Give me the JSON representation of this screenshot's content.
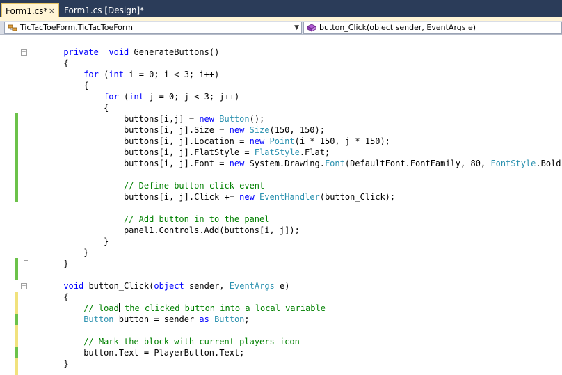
{
  "tabs": [
    {
      "label": "Form1.cs*",
      "close": "×",
      "active": true
    },
    {
      "label": "Form1.cs [Design]*",
      "active": false
    }
  ],
  "nav": {
    "type_combo": "TicTacToeForm.TicTacToeForm",
    "member_combo": "button_Click(object sender, EventArgs e)"
  },
  "colors": {
    "keyword": "#0000ff",
    "type": "#2b91af",
    "comment": "#008000",
    "saved_marker": "#6cc24a",
    "unsaved_marker": "#f1e27d",
    "tab_bg": "#2b3c59"
  },
  "code": {
    "lines": [
      {
        "indent": 6,
        "tokens": [
          [
            "kw",
            "private"
          ],
          [
            "",
            "  "
          ],
          [
            "kw",
            "void"
          ],
          [
            "",
            " GenerateButtons()"
          ]
        ]
      },
      {
        "indent": 6,
        "tokens": [
          [
            "",
            "{"
          ]
        ]
      },
      {
        "indent": 10,
        "tokens": [
          [
            "kw",
            "for"
          ],
          [
            "",
            " ("
          ],
          [
            "kw",
            "int"
          ],
          [
            "",
            " i = 0; i < 3; i++)"
          ]
        ]
      },
      {
        "indent": 10,
        "tokens": [
          [
            "",
            "{"
          ]
        ]
      },
      {
        "indent": 14,
        "tokens": [
          [
            "kw",
            "for"
          ],
          [
            "",
            " ("
          ],
          [
            "kw",
            "int"
          ],
          [
            "",
            " j = 0; j < 3; j++)"
          ]
        ]
      },
      {
        "indent": 14,
        "tokens": [
          [
            "",
            "{"
          ]
        ]
      },
      {
        "indent": 18,
        "tokens": [
          [
            "",
            "buttons[i,j] = "
          ],
          [
            "kw",
            "new"
          ],
          [
            "",
            " "
          ],
          [
            "ty",
            "Button"
          ],
          [
            "",
            "();"
          ]
        ]
      },
      {
        "indent": 18,
        "tokens": [
          [
            "",
            "buttons[i, j].Size = "
          ],
          [
            "kw",
            "new"
          ],
          [
            "",
            " "
          ],
          [
            "ty",
            "Size"
          ],
          [
            "",
            "(150, 150);"
          ]
        ]
      },
      {
        "indent": 18,
        "tokens": [
          [
            "",
            "buttons[i, j].Location = "
          ],
          [
            "kw",
            "new"
          ],
          [
            "",
            " "
          ],
          [
            "ty",
            "Point"
          ],
          [
            "",
            "(i * 150, j * 150);"
          ]
        ]
      },
      {
        "indent": 18,
        "tokens": [
          [
            "",
            "buttons[i, j].FlatStyle = "
          ],
          [
            "ty",
            "FlatStyle"
          ],
          [
            "",
            ".Flat;"
          ]
        ]
      },
      {
        "indent": 18,
        "tokens": [
          [
            "",
            "buttons[i, j].Font = "
          ],
          [
            "kw",
            "new"
          ],
          [
            "",
            " System.Drawing."
          ],
          [
            "ty",
            "Font"
          ],
          [
            "",
            "(DefaultFont.FontFamily, 80, "
          ],
          [
            "ty",
            "FontStyle"
          ],
          [
            "",
            ".Bold);"
          ]
        ]
      },
      {
        "indent": 0,
        "tokens": [
          [
            "",
            ""
          ]
        ]
      },
      {
        "indent": 18,
        "tokens": [
          [
            "cm",
            "// Define button click event"
          ]
        ]
      },
      {
        "indent": 18,
        "tokens": [
          [
            "",
            "buttons[i, j].Click += "
          ],
          [
            "kw",
            "new"
          ],
          [
            "",
            " "
          ],
          [
            "ty",
            "EventHandler"
          ],
          [
            "",
            "(button_Click);"
          ]
        ]
      },
      {
        "indent": 0,
        "tokens": [
          [
            "",
            ""
          ]
        ]
      },
      {
        "indent": 18,
        "tokens": [
          [
            "cm",
            "// Add button in to the panel"
          ]
        ]
      },
      {
        "indent": 18,
        "tokens": [
          [
            "",
            "panel1.Controls.Add(buttons[i, j]);"
          ]
        ]
      },
      {
        "indent": 14,
        "tokens": [
          [
            "",
            "}"
          ]
        ]
      },
      {
        "indent": 10,
        "tokens": [
          [
            "",
            "}"
          ]
        ]
      },
      {
        "indent": 6,
        "tokens": [
          [
            "",
            "}"
          ]
        ]
      },
      {
        "indent": 0,
        "tokens": [
          [
            "",
            ""
          ]
        ]
      },
      {
        "indent": 6,
        "tokens": [
          [
            "kw",
            "void"
          ],
          [
            "",
            " button_Click("
          ],
          [
            "kw",
            "object"
          ],
          [
            "",
            " sender, "
          ],
          [
            "ty",
            "EventArgs"
          ],
          [
            "",
            " e)"
          ]
        ]
      },
      {
        "indent": 6,
        "tokens": [
          [
            "",
            "{"
          ]
        ]
      },
      {
        "indent": 10,
        "tokens": [
          [
            "cm",
            "// load"
          ],
          [
            "caret",
            ""
          ],
          [
            "cm",
            " the clicked button into a local variable"
          ]
        ]
      },
      {
        "indent": 10,
        "tokens": [
          [
            "ty",
            "Button"
          ],
          [
            "",
            " button = sender "
          ],
          [
            "kw",
            "as"
          ],
          [
            "",
            " "
          ],
          [
            "ty",
            "Button"
          ],
          [
            "",
            ";"
          ]
        ]
      },
      {
        "indent": 0,
        "tokens": [
          [
            "",
            ""
          ]
        ]
      },
      {
        "indent": 10,
        "tokens": [
          [
            "cm",
            "// Mark the block with current players icon"
          ]
        ]
      },
      {
        "indent": 10,
        "tokens": [
          [
            "",
            "button.Text = PlayerButton.Text;"
          ]
        ]
      },
      {
        "indent": 6,
        "tokens": [
          [
            "",
            "}"
          ]
        ]
      }
    ]
  }
}
